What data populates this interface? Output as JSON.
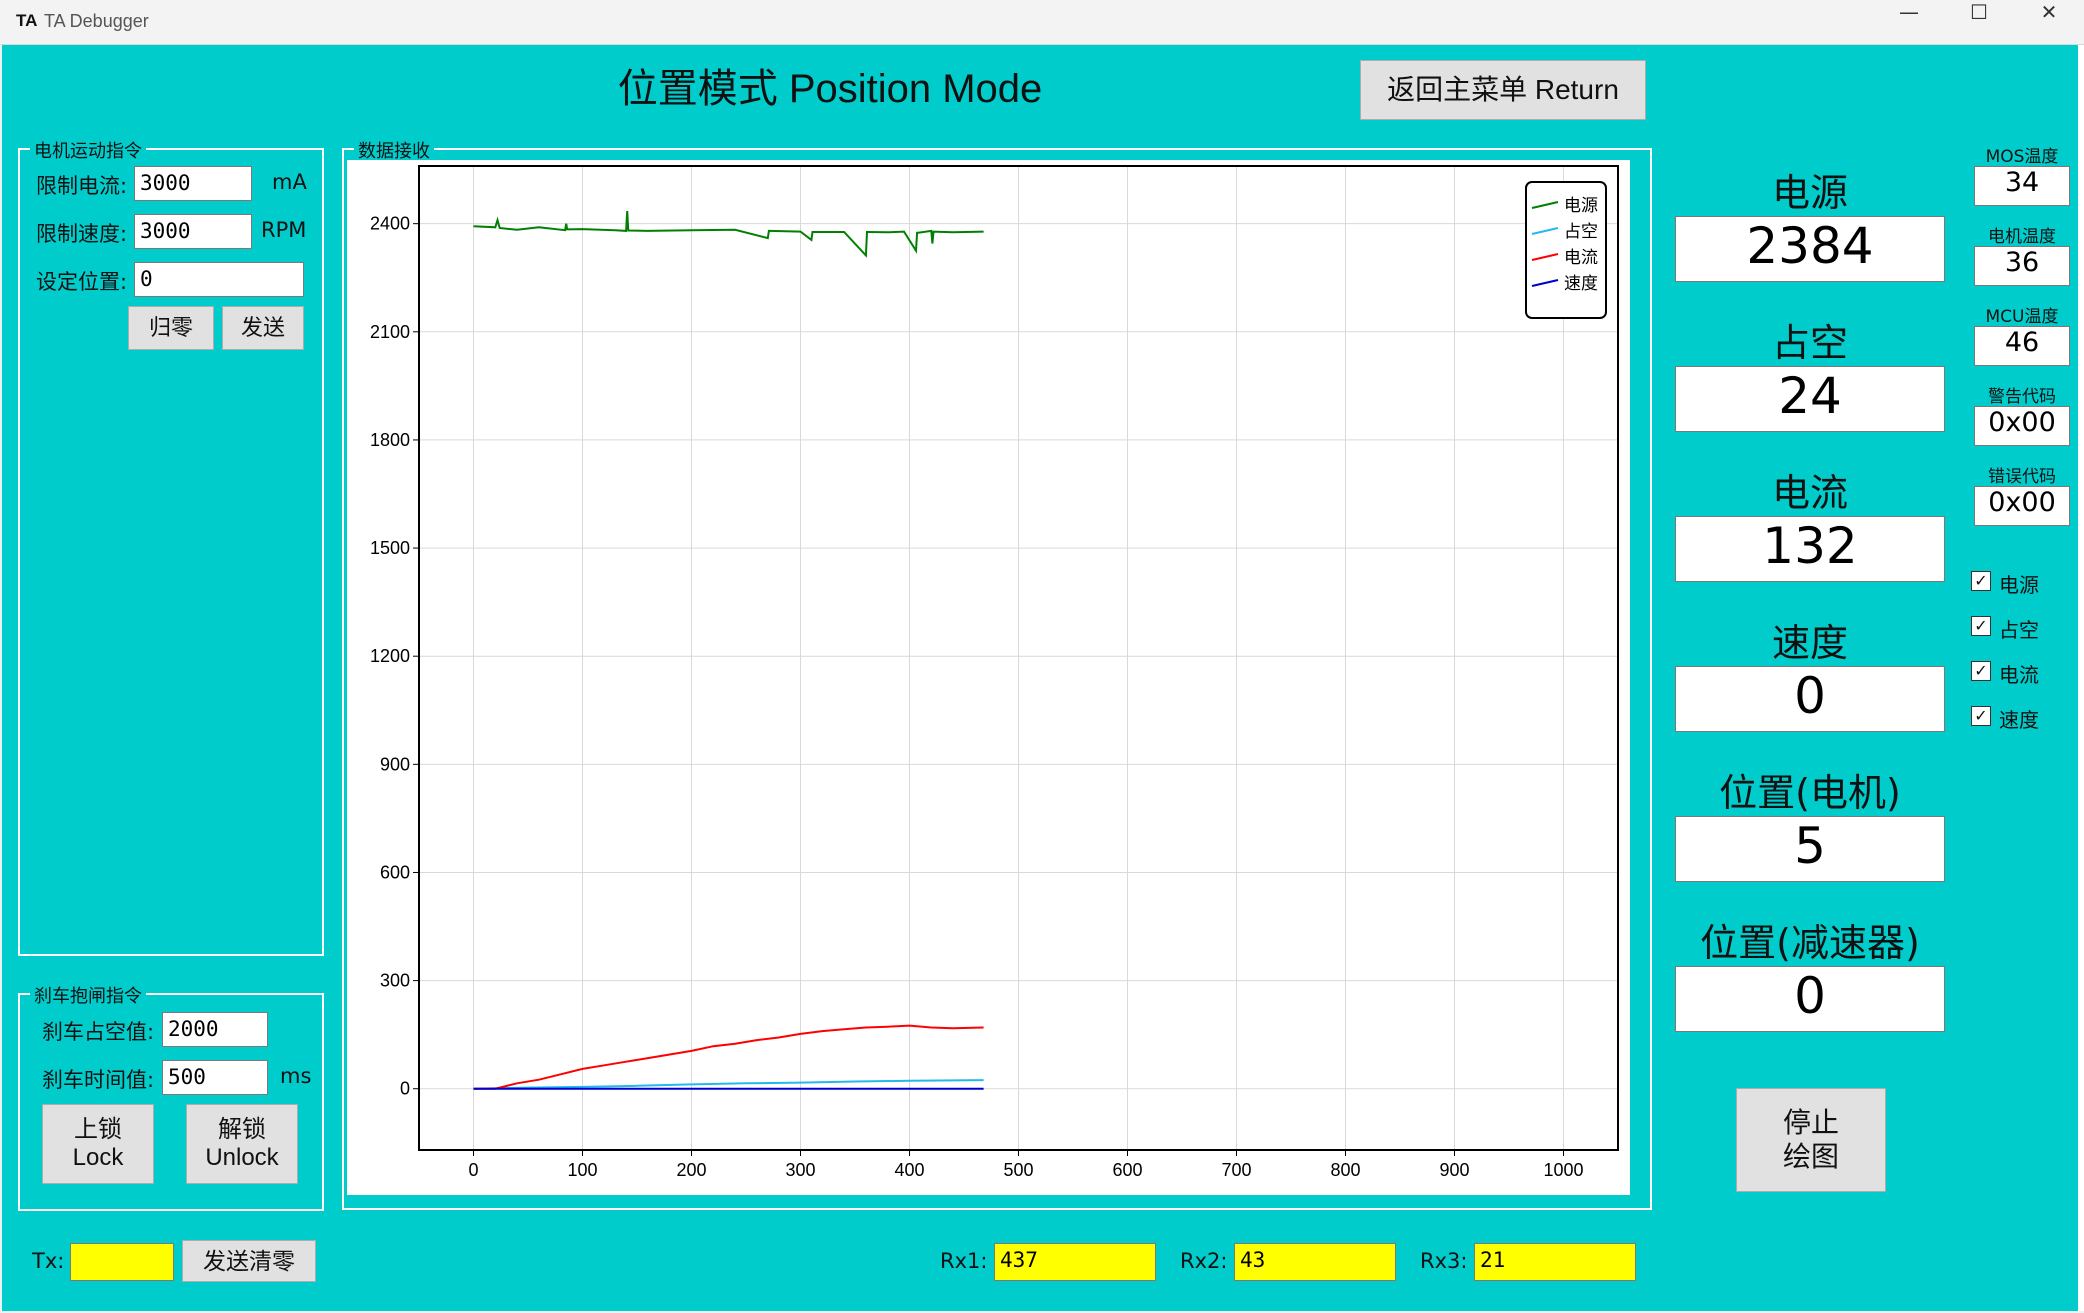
{
  "window": {
    "logo": "TA",
    "title": "TA Debugger",
    "minimize": "—",
    "maximize": "☐",
    "close": "✕"
  },
  "header": {
    "title": "位置模式 Position Mode",
    "return_button": "返回主菜单 Return"
  },
  "motor": {
    "group_title": "电机运动指令",
    "limit_current_label": "限制电流:",
    "limit_current_value": "3000",
    "limit_current_unit": "mA",
    "limit_speed_label": "限制速度:",
    "limit_speed_value": "3000",
    "limit_speed_unit": "RPM",
    "set_position_label": "设定位置:",
    "set_position_value": "0",
    "zero_button": "归零",
    "send_button": "发送"
  },
  "brake": {
    "group_title": "刹车抱闸指令",
    "duty_label": "刹车占空值:",
    "duty_value": "2000",
    "time_label": "刹车时间值:",
    "time_value": "500",
    "time_unit": "ms",
    "lock_button": "上锁\nLock",
    "unlock_button": "解锁\nUnlock"
  },
  "bottom": {
    "tx_label": "Tx:",
    "tx_value": "",
    "clear_button": "发送清零",
    "rx1_label": "Rx1:",
    "rx1_value": "437",
    "rx2_label": "Rx2:",
    "rx2_value": "43",
    "rx3_label": "Rx3:",
    "rx3_value": "21"
  },
  "chart_panel": {
    "group_title": "数据接收"
  },
  "chart_data": {
    "type": "line",
    "xlim": [
      -50,
      1050
    ],
    "ylim": [
      -170,
      2560
    ],
    "xticks": [
      0,
      100,
      200,
      300,
      400,
      500,
      600,
      700,
      800,
      900,
      1000
    ],
    "yticks": [
      0,
      300,
      600,
      900,
      1200,
      1500,
      1800,
      2100,
      2400
    ],
    "grid": true,
    "legend": "top-right",
    "series": [
      {
        "name": "电源",
        "color": "#008000",
        "x": [
          0,
          20,
          22,
          24,
          40,
          60,
          84,
          85,
          86,
          100,
          130,
          140,
          141,
          142,
          160,
          200,
          240,
          270,
          271,
          272,
          300,
          310,
          311,
          312,
          340,
          360,
          361,
          362,
          380,
          395,
          406,
          407,
          408,
          420,
          421,
          422,
          440,
          468
        ],
        "y": [
          2393,
          2390,
          2410,
          2388,
          2383,
          2390,
          2382,
          2400,
          2384,
          2385,
          2382,
          2380,
          2435,
          2381,
          2380,
          2382,
          2383,
          2360,
          2380,
          2380,
          2378,
          2355,
          2377,
          2377,
          2377,
          2312,
          2377,
          2377,
          2376,
          2378,
          2325,
          2375,
          2375,
          2380,
          2345,
          2378,
          2376,
          2378
        ]
      },
      {
        "name": "占空",
        "color": "#22b8f0",
        "x": [
          0,
          50,
          100,
          150,
          200,
          250,
          300,
          350,
          400,
          468
        ],
        "y": [
          0,
          3,
          5,
          8,
          12,
          15,
          17,
          20,
          22,
          24
        ]
      },
      {
        "name": "电流",
        "color": "#ff0000",
        "x": [
          0,
          20,
          40,
          60,
          80,
          100,
          120,
          140,
          160,
          180,
          200,
          220,
          240,
          260,
          280,
          300,
          320,
          340,
          360,
          380,
          400,
          420,
          440,
          468
        ],
        "y": [
          0,
          0,
          15,
          25,
          40,
          55,
          65,
          75,
          85,
          95,
          105,
          118,
          125,
          135,
          142,
          152,
          160,
          165,
          170,
          172,
          175,
          170,
          168,
          170
        ]
      },
      {
        "name": "速度",
        "color": "#0000cc",
        "x": [
          0,
          468
        ],
        "y": [
          0,
          0
        ]
      }
    ]
  },
  "status": {
    "power_label": "电源",
    "power_value": "2384",
    "duty_label": "占空",
    "duty_value": "24",
    "current_label": "电流",
    "current_value": "132",
    "speed_label": "速度",
    "speed_value": "0",
    "pos_motor_label": "位置(电机)",
    "pos_motor_value": "5",
    "pos_reducer_label": "位置(减速器)",
    "pos_reducer_value": "0",
    "mos_temp_label": "MOS温度",
    "mos_temp_value": "34",
    "motor_temp_label": "电机温度",
    "motor_temp_value": "36",
    "mcu_temp_label": "MCU温度",
    "mcu_temp_value": "46",
    "warn_label": "警告代码",
    "warn_value": "0x00",
    "err_label": "错误代码",
    "err_value": "0x00",
    "check_power": "电源",
    "check_duty": "占空",
    "check_current": "电流",
    "check_speed": "速度",
    "check_mark": "✓",
    "stop_button": "停止\n绘图"
  }
}
